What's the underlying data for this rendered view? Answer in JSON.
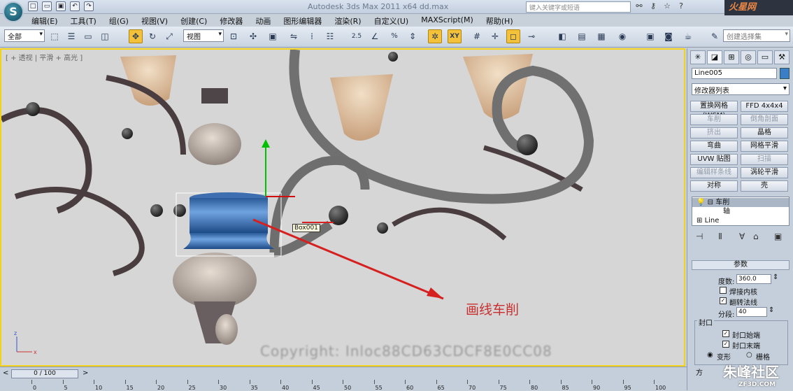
{
  "app": {
    "logo": "S",
    "title": "Autodesk 3ds Max  2011 x64     dd.max",
    "search_placeholder": "键入关键字或短语",
    "brand": "火星网"
  },
  "qat": [
    "□",
    "▭",
    "▣",
    "↶",
    "↷"
  ],
  "menus": [
    "编辑(E)",
    "工具(T)",
    "组(G)",
    "视图(V)",
    "创建(C)",
    "修改器",
    "动画",
    "图形编辑器",
    "渲染(R)",
    "自定义(U)",
    "MAXScript(M)",
    "帮助(H)"
  ],
  "toolbar": {
    "filter": "全部",
    "coord": "视图",
    "selset": "创建选择集",
    "snap_angle": "2.5",
    "xy": "XY",
    "pct": "%"
  },
  "viewport": {
    "label": "[ + 透视 | 平滑 + 高光 ]",
    "box_tip": "Box001",
    "annotation": "画线车削",
    "watermark": "Copyright: Inloc88CD63CDCF8E0CC08"
  },
  "panel": {
    "objname": "Line005",
    "modlist": "修改器列表",
    "buttons": [
      {
        "l": "置换网格 (WSM)",
        "d": false
      },
      {
        "l": "FFD 4x4x4",
        "d": false
      },
      {
        "l": "车削",
        "d": true
      },
      {
        "l": "倒角剖面",
        "d": true
      },
      {
        "l": "挤出",
        "d": true
      },
      {
        "l": "晶格",
        "d": false
      },
      {
        "l": "弯曲",
        "d": false
      },
      {
        "l": "网格平滑",
        "d": false
      },
      {
        "l": "UVW 贴图",
        "d": false
      },
      {
        "l": "扫描",
        "d": true
      },
      {
        "l": "编辑样条线",
        "d": true
      },
      {
        "l": "涡轮平滑",
        "d": false
      },
      {
        "l": "对称",
        "d": false
      },
      {
        "l": "壳",
        "d": false
      }
    ],
    "stack": {
      "lathe": "车削",
      "axis": "轴",
      "line": "Line"
    },
    "params": {
      "head": "参数",
      "degrees_label": "度数:",
      "degrees": "360.0",
      "weld": "焊接内核",
      "flip": "翻转法线",
      "segs_label": "分段:",
      "segs": "40",
      "cap_group": "封口",
      "cap_start": "封口始端",
      "cap_end": "封口末端",
      "morph": "变形",
      "grid": "栅格",
      "dir": "方"
    }
  },
  "timeline": {
    "frame": "0 / 100",
    "ticks": [
      "0",
      "5",
      "10",
      "15",
      "20",
      "25",
      "30",
      "35",
      "40",
      "45",
      "50",
      "55",
      "60",
      "65",
      "70",
      "75",
      "80",
      "85",
      "90",
      "95",
      "100"
    ]
  },
  "footer": {
    "brand": "朱峰社区",
    "url": "ZF3D.COM"
  }
}
